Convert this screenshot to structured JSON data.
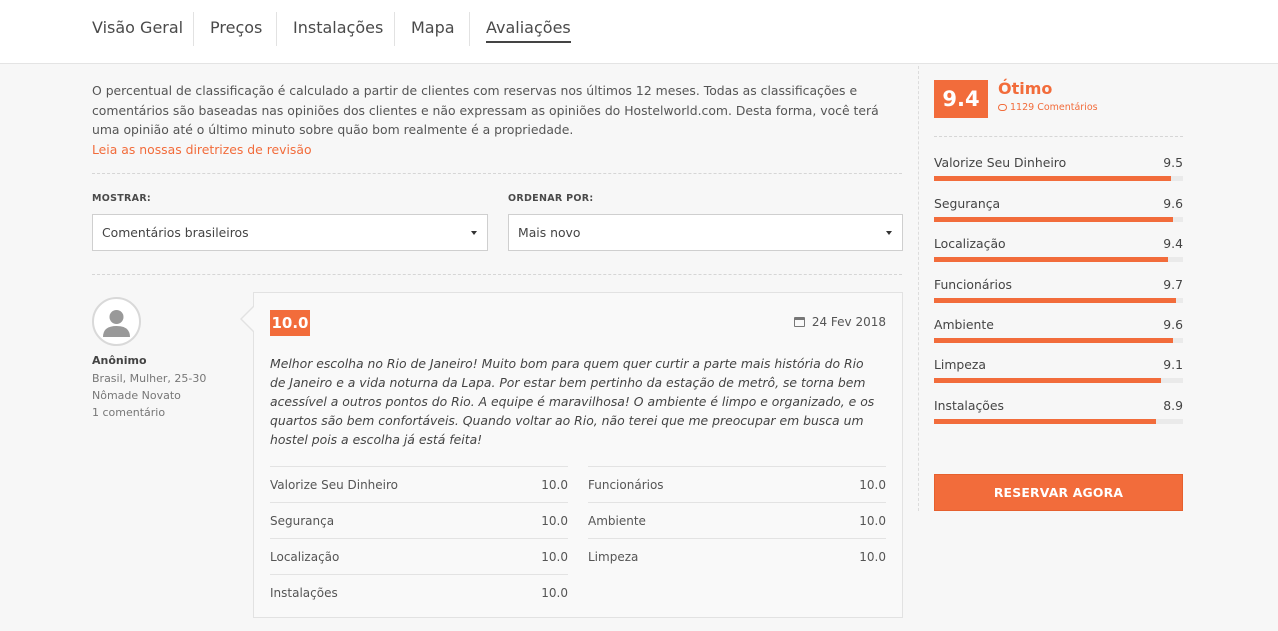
{
  "tabs": [
    {
      "label": "Visão Geral"
    },
    {
      "label": "Preços"
    },
    {
      "label": "Instalações"
    },
    {
      "label": "Mapa"
    },
    {
      "label": "Avaliações",
      "active": true
    }
  ],
  "intro": {
    "text": "O percentual de classificação é calculado a partir de clientes com reservas nos últimos 12 meses. Todas as classificações e comentários são baseadas nas opiniões dos clientes e não expressam as opiniões do Hostelworld.com. Desta forma, você terá uma opinião até o último minuto sobre quão bom realmente é a propriedade.",
    "link": "Leia as nossas diretrizes de revisão"
  },
  "filters": {
    "show_label": "MOSTRAR:",
    "show_value": "Comentários brasileiros",
    "sort_label": "ORDENAR POR:",
    "sort_value": "Mais novo"
  },
  "reviewer": {
    "name": "Anônimo",
    "details": "Brasil, Mulher, 25-30",
    "type": "Nômade Novato",
    "count": "1 comentário"
  },
  "review": {
    "score": "10.0",
    "date": "24 Fev 2018",
    "text": "Melhor escolha no Rio de Janeiro! Muito bom para quem quer curtir a parte mais história do Rio de Janeiro e a vida noturna da Lapa. Por estar bem pertinho da estação de metrô, se torna bem acessível a outros pontos do Rio. A equipe é maravilhosa! O ambiente é limpo e organizado, e os quartos são bem confortáveis. Quando voltar ao Rio, não terei que me preocupar em busca um hostel pois a escolha já está feita!",
    "ratings_left": [
      {
        "name": "Valorize Seu Dinheiro",
        "value": "10.0"
      },
      {
        "name": "Segurança",
        "value": "10.0"
      },
      {
        "name": "Localização",
        "value": "10.0"
      },
      {
        "name": "Instalações",
        "value": "10.0"
      }
    ],
    "ratings_right": [
      {
        "name": "Funcionários",
        "value": "10.0"
      },
      {
        "name": "Ambiente",
        "value": "10.0"
      },
      {
        "name": "Limpeza",
        "value": "10.0"
      }
    ]
  },
  "summary": {
    "score": "9.4",
    "word": "Ótimo",
    "count": "1129 Comentários",
    "categories": [
      {
        "name": "Valorize Seu Dinheiro",
        "value": "9.5",
        "fill_pct": 95
      },
      {
        "name": "Segurança",
        "value": "9.6",
        "fill_pct": 96
      },
      {
        "name": "Localização",
        "value": "9.4",
        "fill_pct": 94
      },
      {
        "name": "Funcionários",
        "value": "9.7",
        "fill_pct": 97
      },
      {
        "name": "Ambiente",
        "value": "9.6",
        "fill_pct": 96
      },
      {
        "name": "Limpeza",
        "value": "9.1",
        "fill_pct": 91
      },
      {
        "name": "Instalações",
        "value": "8.9",
        "fill_pct": 89
      }
    ],
    "book_label": "RESERVAR AGORA"
  },
  "colors": {
    "accent": "#f26c3b"
  }
}
